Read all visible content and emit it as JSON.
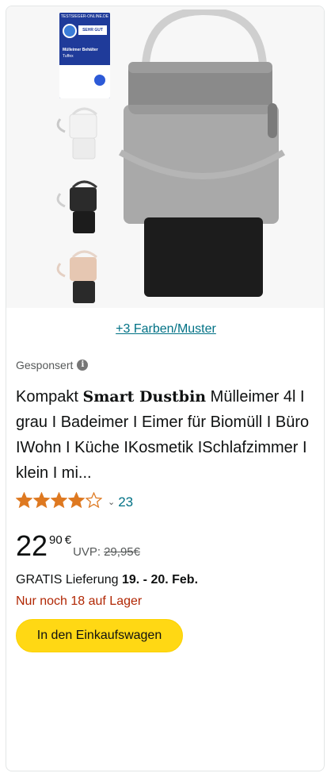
{
  "image": {
    "badge": {
      "header": "TESTSIEGER-ONLINE.DE",
      "grade": "SEHR GUT (1,7)",
      "product_type": "Mülleimer Behälter",
      "brand": "Tuffex"
    }
  },
  "colors_link": "+3 Farben/Muster",
  "sponsored_label": "Gesponsert",
  "title": {
    "prefix": "Kompakt ",
    "bold": "Smart Dustbin",
    "rest": " Mülleimer 4l I grau I Badeimer I Eimer für Biomüll I Büro IWohn I Küche IKosmetik ISchlafzimmer I klein I mi..."
  },
  "rating": {
    "stars": 4,
    "max": 5,
    "count": "23"
  },
  "price": {
    "whole": "22",
    "fraction": "90",
    "currency": "€",
    "uvp_label": "UVP:",
    "uvp_value": "29,95€"
  },
  "delivery": {
    "prefix": "GRATIS Lieferung ",
    "dates": "19. - 20. Feb."
  },
  "stock": "Nur noch 18 auf Lager",
  "cart_button": "In den Einkaufswagen",
  "theme": {
    "link": "#007185",
    "stock": "#b12704",
    "button": "#ffd814",
    "star": "#de7921"
  }
}
